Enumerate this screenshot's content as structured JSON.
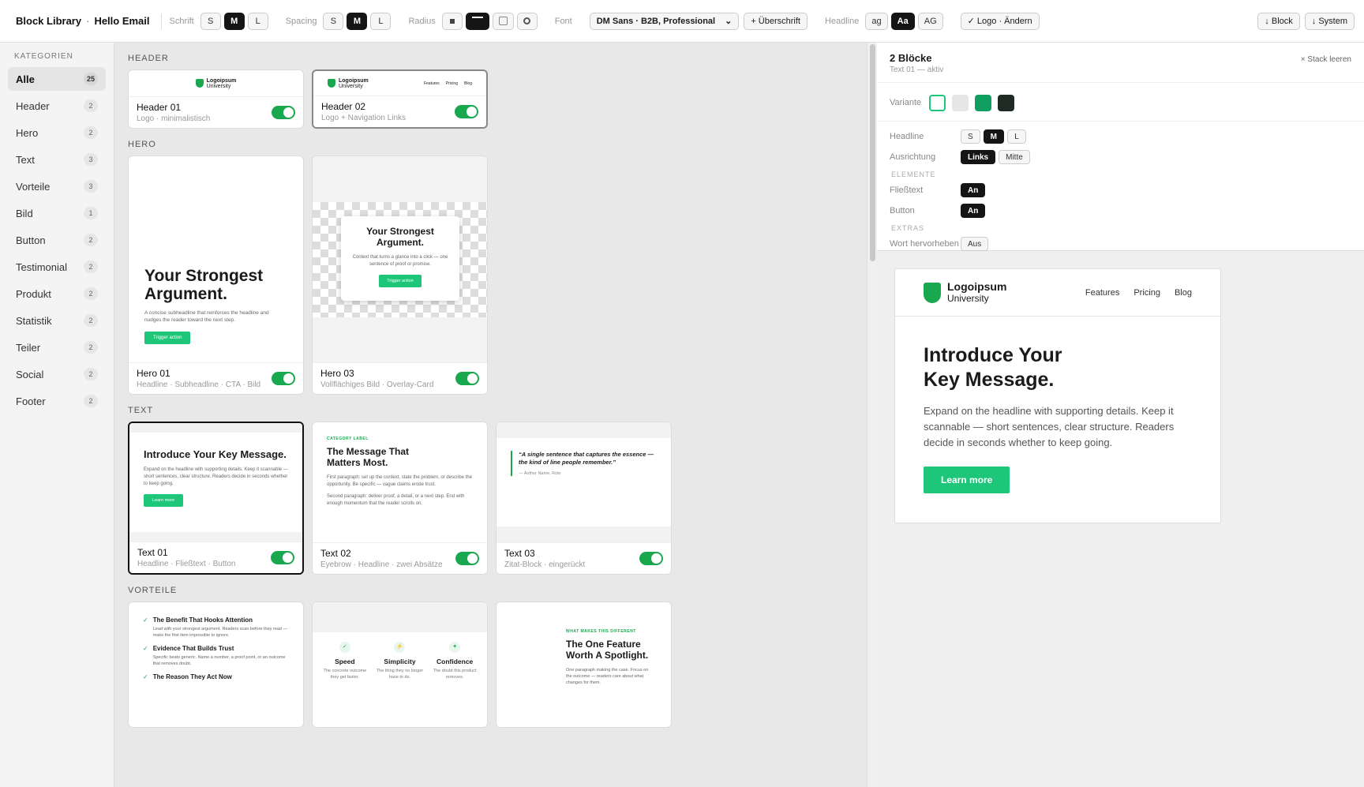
{
  "topbar": {
    "title": "Block Library",
    "sep": "·",
    "project": "Hello Email",
    "schrift_label": "Schrift",
    "schrift_opts": [
      "S",
      "M",
      "L"
    ],
    "spacing_label": "Spacing",
    "spacing_opts": [
      "S",
      "M",
      "L"
    ],
    "radius_label": "Radius",
    "font_label": "Font",
    "font_value": "DM Sans · B2B, Professional",
    "add_heading": "+ Überschrift",
    "headline_label": "Headline",
    "headline_opts": [
      "ag",
      "Aa",
      "AG"
    ],
    "logo_btn": "✓ Logo · Ändern",
    "block_btn": "↓ Block",
    "system_btn": "↓ System"
  },
  "sidebar": {
    "heading": "KATEGORIEN",
    "items": [
      {
        "label": "Alle",
        "count": "25"
      },
      {
        "label": "Header",
        "count": "2"
      },
      {
        "label": "Hero",
        "count": "2"
      },
      {
        "label": "Text",
        "count": "3"
      },
      {
        "label": "Vorteile",
        "count": "3"
      },
      {
        "label": "Bild",
        "count": "1"
      },
      {
        "label": "Button",
        "count": "2"
      },
      {
        "label": "Testimonial",
        "count": "2"
      },
      {
        "label": "Produkt",
        "count": "2"
      },
      {
        "label": "Statistik",
        "count": "2"
      },
      {
        "label": "Teiler",
        "count": "2"
      },
      {
        "label": "Social",
        "count": "2"
      },
      {
        "label": "Footer",
        "count": "2"
      }
    ]
  },
  "sections": {
    "header": "HEADER",
    "hero": "HERO",
    "text": "TEXT",
    "vorteile": "VORTEILE"
  },
  "logo": {
    "name": "Logoipsum",
    "sub": "University"
  },
  "nav": [
    "Features",
    "Pricing",
    "Blog"
  ],
  "cards": {
    "h1": {
      "title": "Header 01",
      "sub": "Logo · minimalistisch"
    },
    "h2": {
      "title": "Header 02",
      "sub": "Logo + Navigation Links"
    },
    "hero1": {
      "title": "Hero 01",
      "sub": "Headline · Subheadline · CTA · Bild",
      "headline": "Your Strongest Argument.",
      "body": "A concise subheadline that reinforces the headline and nudges the reader toward the next step.",
      "cta": "Trigger action"
    },
    "hero3": {
      "title": "Hero 03",
      "sub": "Vollflächiges Bild · Overlay-Card",
      "headline": "Your Strongest Argument.",
      "body": "Context that turns a glance into a click — one sentence of proof or promise.",
      "cta": "Trigger action"
    },
    "t1": {
      "title": "Text 01",
      "sub": "Headline · Fließtext · Button",
      "headline": "Introduce Your Key Message.",
      "body": "Expand on the headline with supporting details. Keep it scannable — short sentences, clear structure. Readers decide in seconds whether to keep going.",
      "cta": "Learn more"
    },
    "t2": {
      "title": "Text 02",
      "sub": "Eyebrow · Headline · zwei Absätze",
      "eyebrow": "CATEGORY LABEL",
      "headline": "The Message That Matters Most.",
      "p1": "First paragraph: set up the context, state the problem, or describe the opportunity. Be specific — vague claims erode trust.",
      "p2": "Second paragraph: deliver proof, a detail, or a next step. End with enough momentum that the reader scrolls on."
    },
    "t3": {
      "title": "Text 03",
      "sub": "Zitat-Block · eingerückt",
      "quote": "“A single sentence that captures the essence — the kind of line people remember.”",
      "author": "— Author Name, Role"
    },
    "v1": {
      "items": [
        {
          "t": "The Benefit That Hooks Attention",
          "d": "Lead with your strongest argument. Readers scan before they read — make the first item impossible to ignore."
        },
        {
          "t": "Evidence That Builds Trust",
          "d": "Specific beats generic. Name a number, a proof point, or an outcome that removes doubt."
        },
        {
          "t": "The Reason They Act Now",
          "d": ""
        }
      ]
    },
    "v2": {
      "cols": [
        {
          "t": "Speed",
          "d": "The concrete outcome they get faster."
        },
        {
          "t": "Simplicity",
          "d": "The thing they no longer have to do."
        },
        {
          "t": "Confidence",
          "d": "The doubt this product removes."
        }
      ]
    },
    "v3": {
      "eyebrow": "WHAT MAKES THIS DIFFERENT",
      "headline": "The One Feature Worth A Spotlight.",
      "body": "One paragraph making the case. Focus on the outcome — readers care about what changes for them."
    }
  },
  "panel": {
    "count": "2 Blöcke",
    "active": "Text 01 — aktiv",
    "clear": "× Stack leeren",
    "variante": "Variante",
    "headline_label": "Headline",
    "headline_opts": [
      "S",
      "M",
      "L"
    ],
    "ausrichtung": "Ausrichtung",
    "links": "Links",
    "mitte": "Mitte",
    "elemente": "ELEMENTE",
    "fliesstext": "Fließtext",
    "fliesstext_val": "An",
    "button": "Button",
    "button_val": "An",
    "extras": "EXTRAS",
    "wort": "Wort hervorheben",
    "wort_val": "Aus",
    "preview": {
      "headline": "Introduce Your Key Message.",
      "body": "Expand on the headline with supporting details. Keep it scannable — short sentences, clear structure. Readers decide in seconds whether to keep going.",
      "cta": "Learn more"
    }
  },
  "colors": {
    "accent": "#1ec67a",
    "toggle": "#1aa84e",
    "dark": "#151515"
  }
}
